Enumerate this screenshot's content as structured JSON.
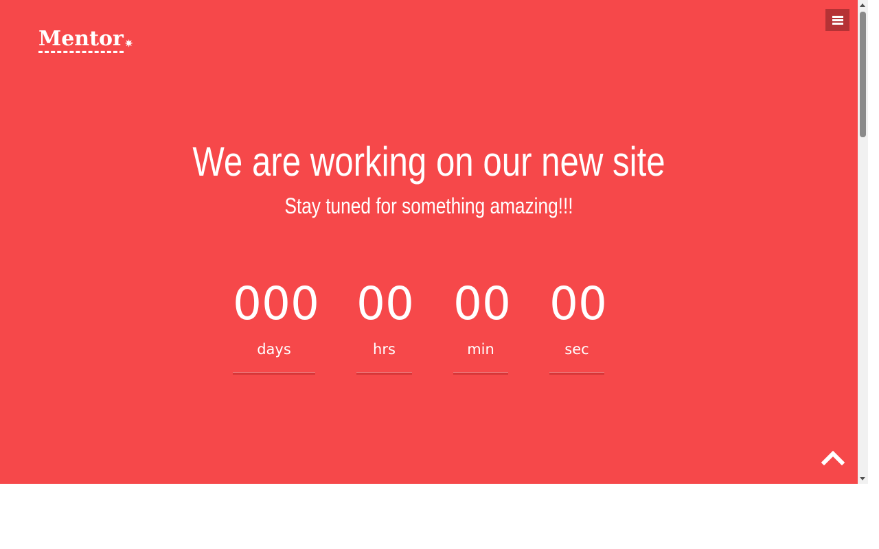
{
  "header": {
    "logo_text": "Mentor",
    "logo_mark": "✷"
  },
  "hero": {
    "title": "We are working on our new site",
    "subtitle": "Stay tuned for something amazing!!!"
  },
  "countdown": {
    "days": {
      "value": "000",
      "label": "days"
    },
    "hrs": {
      "value": "00",
      "label": "hrs"
    },
    "min": {
      "value": "00",
      "label": "min"
    },
    "sec": {
      "value": "00",
      "label": "sec"
    }
  },
  "icons": {
    "menu": "hamburger-icon",
    "scroll_top": "chevron-up-icon"
  },
  "colors": {
    "background": "#f6484a",
    "menu_button": "#b53235",
    "text": "#ffffff",
    "underline": "#d63638"
  }
}
